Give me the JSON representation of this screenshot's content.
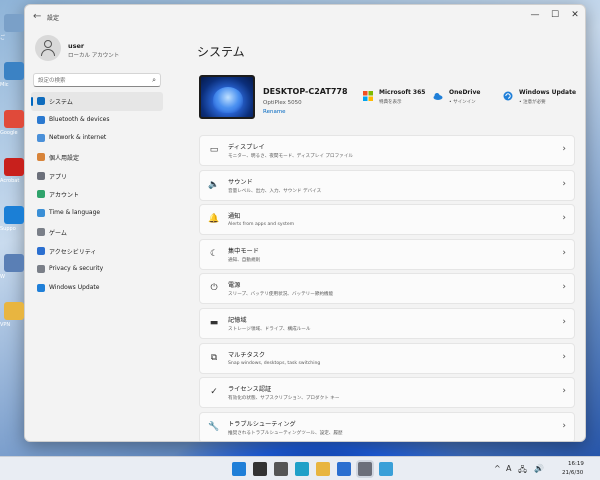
{
  "desktop_icons": [
    {
      "name": "recycle-bin",
      "color": "#7aa0c8",
      "label": "ご"
    },
    {
      "name": "app-1",
      "color": "#3b82c4",
      "label": "Mic"
    },
    {
      "name": "chrome",
      "color": "#e04a3a",
      "label": "Google"
    },
    {
      "name": "acrobat",
      "color": "#c8201c",
      "label": "Acrobat"
    },
    {
      "name": "support",
      "color": "#1b7fd6",
      "label": "Suppo"
    },
    {
      "name": "app-2",
      "color": "#5a7fb5",
      "label": "W"
    },
    {
      "name": "folder",
      "color": "#e8b540",
      "label": "VPN"
    }
  ],
  "window": {
    "title": "設定",
    "back_symbol": "←",
    "controls": {
      "minimize": "—",
      "maximize": "☐",
      "close": "✕"
    }
  },
  "user": {
    "name": "user",
    "type": "ローカル アカウント"
  },
  "search": {
    "placeholder": "設定の検索"
  },
  "sidebar": {
    "items": [
      {
        "label": "システム",
        "icon": "monitor-icon",
        "color": "#0f6cbd",
        "active": true
      },
      {
        "label": "Bluetooth & devices",
        "icon": "bluetooth-icon",
        "color": "#2b79d0"
      },
      {
        "label": "Network & internet",
        "icon": "network-icon",
        "color": "#4a90d9"
      },
      {
        "label": "個人用設定",
        "icon": "brush-icon",
        "color": "#d8843a"
      },
      {
        "label": "アプリ",
        "icon": "apps-icon",
        "color": "#6b6f7a"
      },
      {
        "label": "アカウント",
        "icon": "account-icon",
        "color": "#2fa36b"
      },
      {
        "label": "Time & language",
        "icon": "globe-icon",
        "color": "#3a8fd6"
      },
      {
        "label": "ゲーム",
        "icon": "gamepad-icon",
        "color": "#7a7f88"
      },
      {
        "label": "アクセシビリティ",
        "icon": "accessibility-icon",
        "color": "#2b6fd0"
      },
      {
        "label": "Privacy & security",
        "icon": "shield-icon",
        "color": "#7a7f88"
      },
      {
        "label": "Windows Update",
        "icon": "update-icon",
        "color": "#1f7fd8"
      }
    ]
  },
  "main": {
    "title": "システム",
    "device": {
      "name": "DESKTOP-C2AT778",
      "model": "OptiPlex 5050",
      "rename": "Rename"
    },
    "status": [
      {
        "title": "Microsoft 365",
        "sub": "特典を表示",
        "icon": "microsoft-icon"
      },
      {
        "title": "OneDrive",
        "sub": "• サインイン",
        "icon": "cloud-icon"
      },
      {
        "title": "Windows Update",
        "sub": "• 注意が必要",
        "icon": "update-icon"
      }
    ],
    "cards": [
      {
        "title": "ディスプレイ",
        "sub": "モニター、明るさ、夜間モード、ディスプレイ プロファイル",
        "icon": "display-icon",
        "glyph": "▭"
      },
      {
        "title": "サウンド",
        "sub": "音量レベル、出力、入力、サウンド デバイス",
        "icon": "speaker-icon",
        "glyph": "🔈"
      },
      {
        "title": "通知",
        "sub": "Alerts from apps and system",
        "icon": "bell-icon",
        "glyph": "🔔"
      },
      {
        "title": "集中モード",
        "sub": "通知、自動規則",
        "icon": "moon-icon",
        "glyph": "☾"
      },
      {
        "title": "電源",
        "sub": "スリープ、バッテリ使用状況、バッテリー節約機能",
        "icon": "power-icon",
        "glyph": "⏻"
      },
      {
        "title": "記憶域",
        "sub": "ストレージ領域、ドライブ、構成ルール",
        "icon": "storage-icon",
        "glyph": "▬"
      },
      {
        "title": "マルチタスク",
        "sub": "Snap windows, desktops, task switching",
        "icon": "multitask-icon",
        "glyph": "⧉"
      },
      {
        "title": "ライセンス認証",
        "sub": "有効化の状態、サブスクリプション、プロダクト キー",
        "icon": "check-circle-icon",
        "glyph": "✓"
      },
      {
        "title": "トラブルシューティング",
        "sub": "推奨されるトラブルシューティングツール、設定、履歴",
        "icon": "wrench-icon",
        "glyph": "🔧"
      }
    ],
    "chevron": "›"
  },
  "taskbar": {
    "apps": [
      {
        "name": "start-button",
        "color": "#1f7fd8"
      },
      {
        "name": "search-button",
        "color": "#333333"
      },
      {
        "name": "task-view-button",
        "color": "#555555"
      },
      {
        "name": "edge-button",
        "color": "#1fa0c8"
      },
      {
        "name": "file-explorer-button",
        "color": "#e8b540"
      },
      {
        "name": "store-button",
        "color": "#2b6fd0"
      },
      {
        "name": "settings-button",
        "color": "#6b6f7a"
      },
      {
        "name": "app-button",
        "color": "#3aa0d8"
      }
    ],
    "tray": {
      "chevron": "^",
      "ime": "A",
      "network": "🖧",
      "volume": "🔊"
    },
    "time": "16:19",
    "date": "21/6/30"
  }
}
